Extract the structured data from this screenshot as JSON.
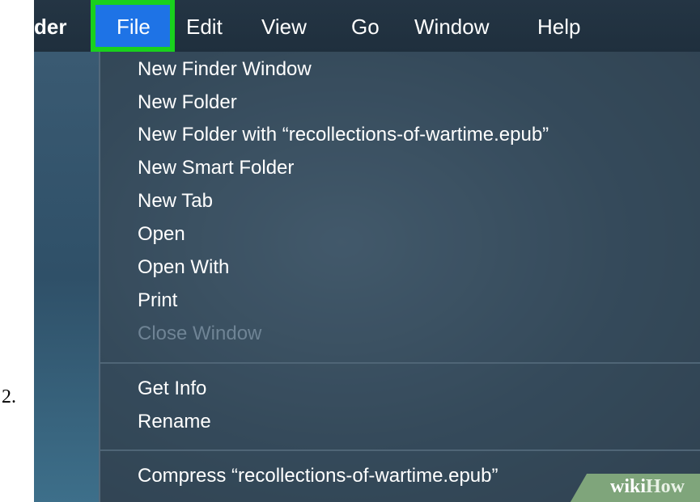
{
  "step_number": "2.",
  "menubar": {
    "app_name": "der",
    "menus": [
      "File",
      "Edit",
      "View",
      "Go",
      "Window",
      "Help"
    ],
    "highlight_color": "#19d11d",
    "selected_color": "#1e73e6"
  },
  "file_menu": {
    "items": [
      "New Finder Window",
      "New Folder",
      "New Folder with “recollections-of-wartime.epub”",
      "New Smart Folder",
      "New Tab",
      "Open",
      "Open With",
      "Print",
      "Close Window",
      "Get Info",
      "Rename",
      "Compress “recollections-of-wartime.epub”"
    ]
  },
  "watermark": {
    "wiki": "wiki",
    "how": "How"
  }
}
